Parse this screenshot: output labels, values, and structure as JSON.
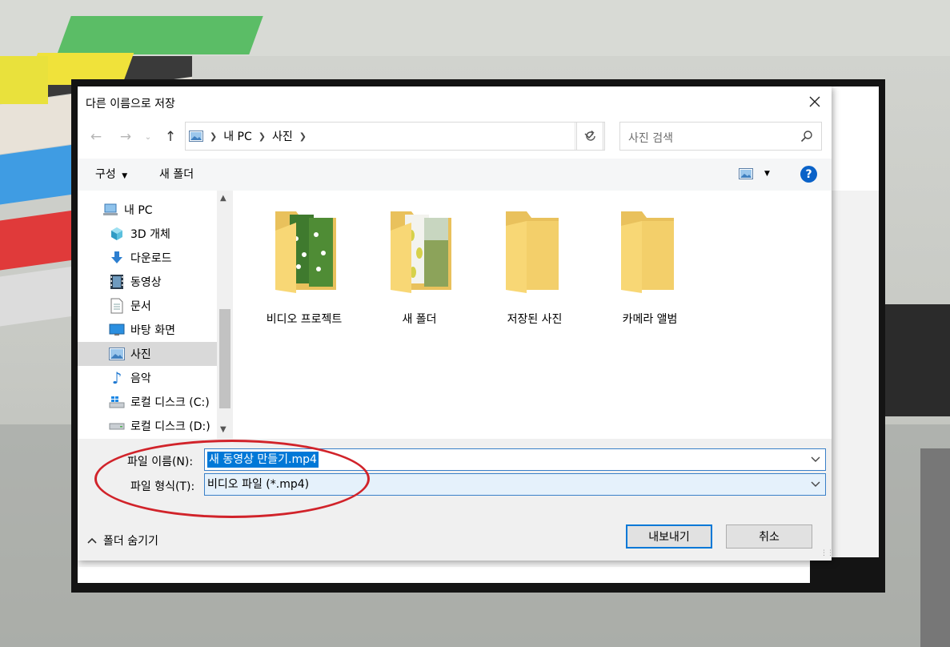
{
  "dialog": {
    "title": "다른 이름으로 저장"
  },
  "address": {
    "crumbs": [
      "내 PC",
      "사진"
    ]
  },
  "search": {
    "placeholder": "사진 검색"
  },
  "toolbar": {
    "organize": "구성",
    "new_folder": "새 폴더"
  },
  "nav": {
    "items": [
      {
        "label": "내 PC",
        "icon": "computer-icon"
      },
      {
        "label": "3D 개체",
        "icon": "cube-icon"
      },
      {
        "label": "다운로드",
        "icon": "download-icon"
      },
      {
        "label": "동영상",
        "icon": "film-icon"
      },
      {
        "label": "문서",
        "icon": "document-icon"
      },
      {
        "label": "바탕 화면",
        "icon": "desktop-icon"
      },
      {
        "label": "사진",
        "icon": "picture-icon"
      },
      {
        "label": "음악",
        "icon": "music-icon"
      },
      {
        "label": "로컬 디스크 (C:)",
        "icon": "windows-drive-icon"
      },
      {
        "label": "로컬 디스크 (D:)",
        "icon": "drive-icon"
      }
    ],
    "selected": "사진"
  },
  "folders": [
    {
      "label": "비디오 프로젝트",
      "type": "photo-flowers"
    },
    {
      "label": "새 폴더",
      "type": "photo-leaves"
    },
    {
      "label": "저장된 사진",
      "type": "plain"
    },
    {
      "label": "카메라 앨범",
      "type": "plain"
    }
  ],
  "form": {
    "filename_label": "파일 이름(N):",
    "filename_value": "새 동영상 만들기.mp4",
    "filetype_label": "파일 형식(T):",
    "filetype_value": "비디오 파일 (*.mp4)"
  },
  "footer": {
    "hide_folders": "폴더 숨기기",
    "save": "내보내기",
    "cancel": "취소"
  },
  "colors": {
    "accent": "#0078d7",
    "highlight_ellipse": "#d1232a",
    "folder_yellow": "#f8d775"
  }
}
